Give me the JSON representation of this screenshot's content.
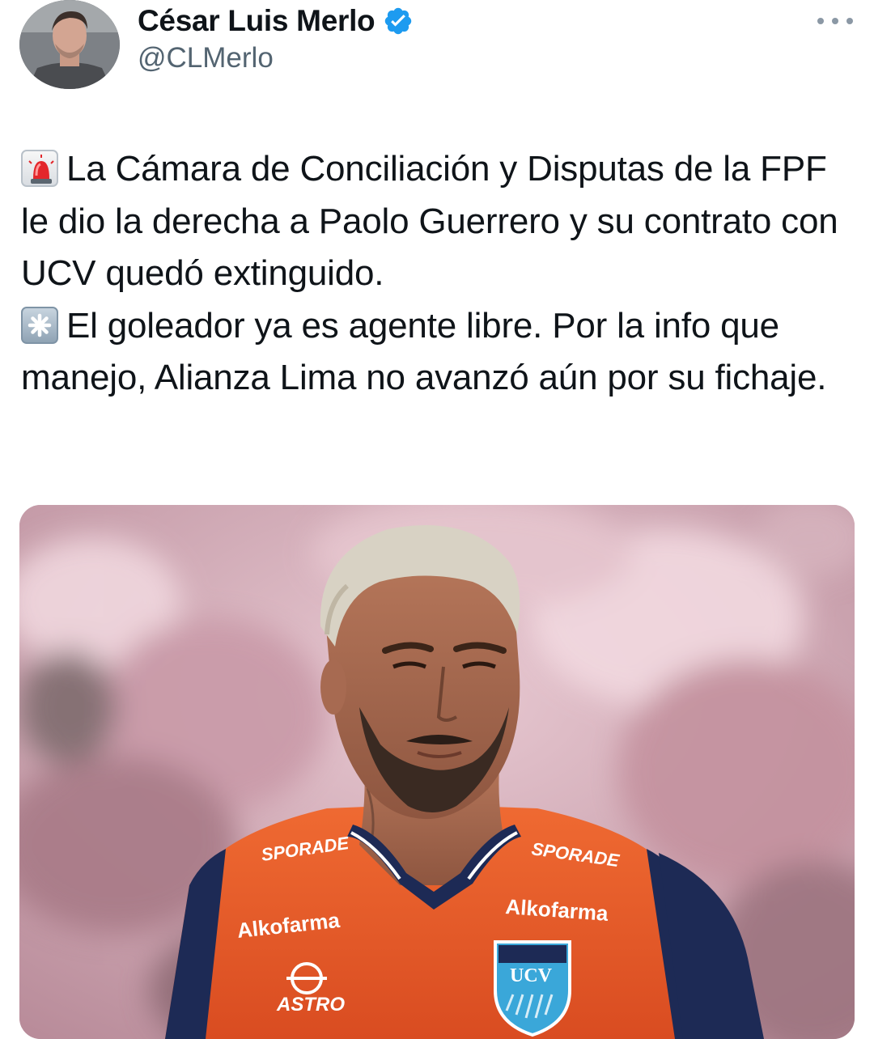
{
  "author": {
    "display_name": "César Luis Merlo",
    "handle": "@CLMerlo",
    "verified": true,
    "verified_color": "#1d9bf0"
  },
  "more_icon": "more-horizontal-icon",
  "tweet": {
    "paragraph_1_emoji": "police-car-light-emoji",
    "paragraph_1": "La Cámara de Conciliación y Disputas de la FPF le dio la derecha a Paolo Guerrero y su contrato con UCV quedó extinguido.",
    "paragraph_2_emoji": "eight-spoked-asterisk-emoji",
    "paragraph_2": "El goleador ya es agente libre. Por la info que manejo, Alianza Lima no avanzó aún por su fichaje."
  },
  "media": {
    "jersey_text": {
      "sponsor_1": "SPORADE",
      "sponsor_2": "Alkofarma",
      "sponsor_3": "ASTRO",
      "crest": "UCV"
    },
    "colors": {
      "jersey": "#e85a2a",
      "jersey_trim": "#1d2a55",
      "background": "#d9aebd"
    }
  }
}
